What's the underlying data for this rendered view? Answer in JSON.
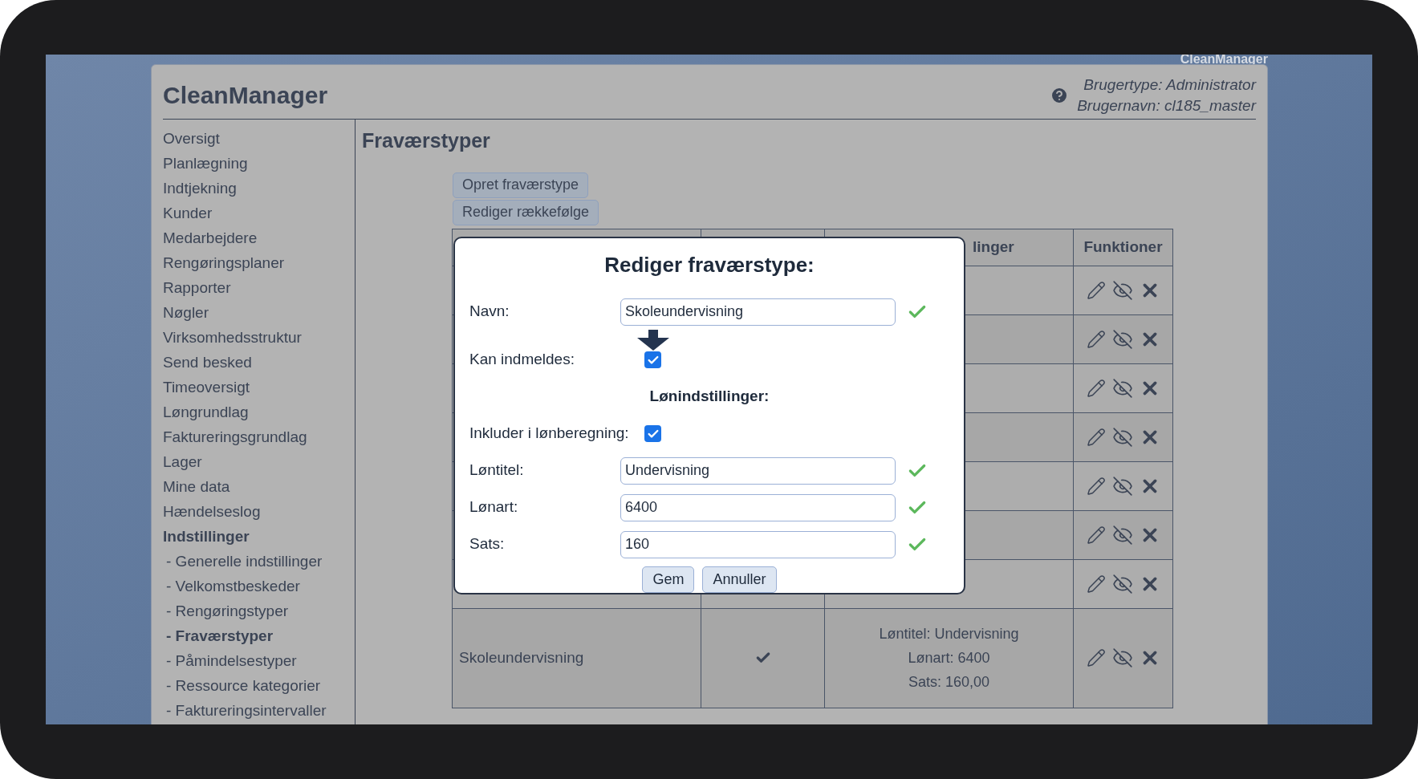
{
  "top_brand": "CleanManager",
  "header": {
    "title": "CleanManager",
    "user_type": "Brugertype: Administrator",
    "user_name": "Brugernavn: cl185_master"
  },
  "sidebar": {
    "items": [
      {
        "label": "Oversigt",
        "selected": false
      },
      {
        "label": "Planlægning",
        "selected": false
      },
      {
        "label": "Indtjekning",
        "selected": false
      },
      {
        "label": "Kunder",
        "selected": false
      },
      {
        "label": "Medarbejdere",
        "selected": false
      },
      {
        "label": "Rengøringsplaner",
        "selected": false
      },
      {
        "label": "Rapporter",
        "selected": false
      },
      {
        "label": "Nøgler",
        "selected": false
      },
      {
        "label": "Virksomhedsstruktur",
        "selected": false
      },
      {
        "label": "Send besked",
        "selected": false
      },
      {
        "label": "Timeoversigt",
        "selected": false
      },
      {
        "label": "Løngrundlag",
        "selected": false
      },
      {
        "label": "Faktureringsgrundlag",
        "selected": false
      },
      {
        "label": "Lager",
        "selected": false
      },
      {
        "label": "Mine data",
        "selected": false
      },
      {
        "label": "Hændelseslog",
        "selected": false
      },
      {
        "label": "Indstillinger",
        "selected": true,
        "children": [
          {
            "label": "- Generelle indstillinger",
            "selected": false
          },
          {
            "label": "- Velkomstbeskeder",
            "selected": false
          },
          {
            "label": "- Rengøringstyper",
            "selected": false
          },
          {
            "label": "- Fraværstyper",
            "selected": true
          },
          {
            "label": "- Påmindelsestyper",
            "selected": false
          },
          {
            "label": "- Ressource kategorier",
            "selected": false
          },
          {
            "label": "- Faktureringsintervaller",
            "selected": false
          }
        ]
      }
    ]
  },
  "content": {
    "title": "Fraværstyper",
    "buttons": [
      "Opret fraværstype",
      "Rediger rækkefølge"
    ],
    "table": {
      "column_3": "linger",
      "column_4": "Funktioner",
      "rows": [
        {
          "kind": "covered"
        },
        {
          "kind": "covered"
        },
        {
          "kind": "covered"
        },
        {
          "kind": "covered"
        },
        {
          "kind": "covered"
        },
        {
          "kind": "covered"
        },
        {
          "kind": "covered"
        },
        {
          "kind": "full",
          "name": "Skoleundervisning",
          "checked": true,
          "pay_lines": [
            "Løntitel: Undervisning",
            "Lønart: 6400",
            "Sats: 160,00"
          ]
        }
      ]
    }
  },
  "dialog": {
    "title": "Rediger fraværstype:",
    "fields": [
      {
        "kind": "text",
        "label": "Navn:",
        "value": "Skoleundervisning",
        "valid": true
      },
      {
        "kind": "checkbox",
        "label": "Kan indmeldes:",
        "checked": true,
        "highlighted": true
      },
      {
        "kind": "heading",
        "label": "Lønindstillinger:"
      },
      {
        "kind": "checkbox",
        "label": "Inkluder i lønberegning:",
        "checked": true
      },
      {
        "kind": "text",
        "label": "Løntitel:",
        "value": "Undervisning",
        "valid": true
      },
      {
        "kind": "text",
        "label": "Lønart:",
        "value": "6400",
        "valid": true
      },
      {
        "kind": "text",
        "label": "Sats:",
        "value": "160",
        "valid": true
      }
    ],
    "buttons": [
      "Gem",
      "Annuller"
    ]
  }
}
